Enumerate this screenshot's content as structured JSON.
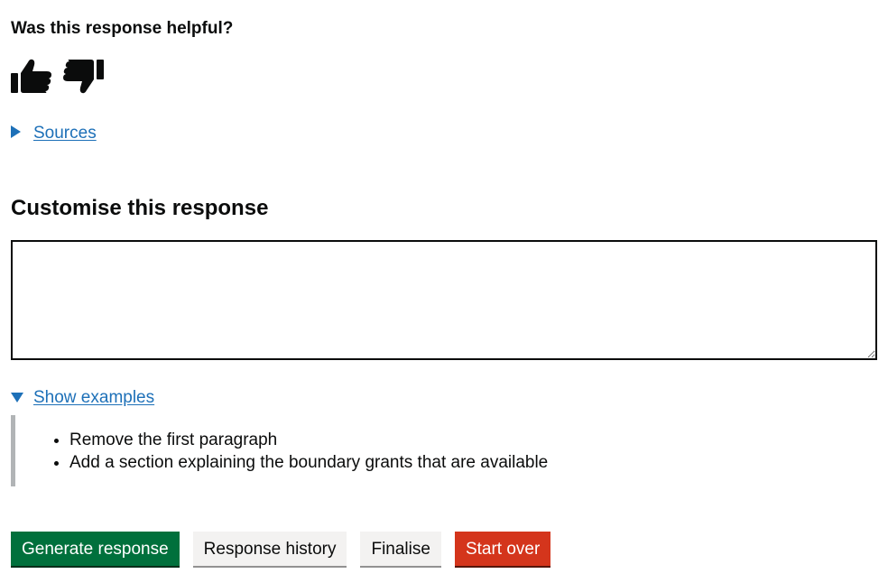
{
  "feedback": {
    "question": "Was this response helpful?",
    "thumbs_up_icon": "thumbs-up-icon",
    "thumbs_down_icon": "thumbs-down-icon"
  },
  "sources": {
    "label": "Sources",
    "expanded": false
  },
  "customise": {
    "heading": "Customise this response",
    "textarea_value": ""
  },
  "examples": {
    "label": "Show examples",
    "expanded": true,
    "items": [
      "Remove the first paragraph",
      "Add a section explaining the boundary grants that are available"
    ]
  },
  "actions": {
    "generate_label": "Generate response",
    "history_label": "Response history",
    "finalise_label": "Finalise",
    "start_over_label": "Start over"
  },
  "colors": {
    "link": "#1d70b8",
    "primary_button": "#00703c",
    "secondary_button": "#f3f2f1",
    "warning_button": "#d4351c",
    "inset_border": "#b1b4b6"
  }
}
